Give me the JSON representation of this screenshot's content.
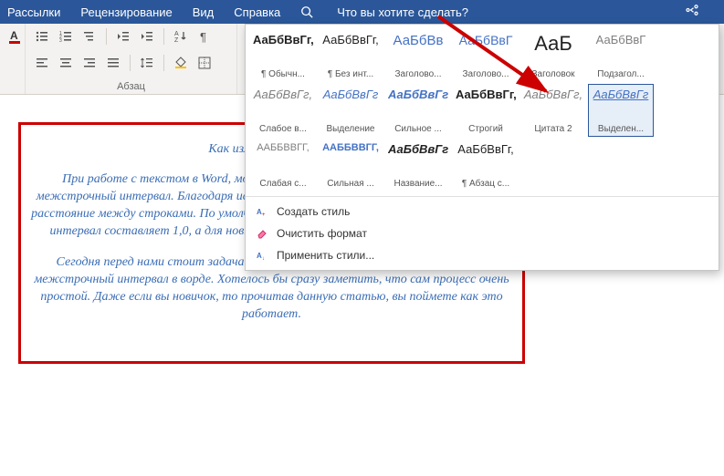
{
  "menubar": {
    "items": [
      "Рассылки",
      "Рецензирование",
      "Вид",
      "Справка"
    ],
    "search_placeholder": "Что вы хотите сделать?"
  },
  "ribbon": {
    "paragraph_label": "Абзац"
  },
  "styles": {
    "tiles": [
      {
        "sample": "АаБбВвГг,",
        "name": "¶ Обычн...",
        "css": "color:#222;font-weight:600"
      },
      {
        "sample": "АаБбВвГг,",
        "name": "¶ Без инт...",
        "css": "color:#222"
      },
      {
        "sample": "АаБбВв",
        "name": "Заголово...",
        "css": "color:#4472c4;font-size:15px"
      },
      {
        "sample": "АаБбВвГ",
        "name": "Заголово...",
        "css": "color:#4472c4;font-size:14px"
      },
      {
        "sample": "АаБ",
        "name": "Заголовок",
        "css": "color:#222;font-size:22px"
      },
      {
        "sample": "АаБбВвГ",
        "name": "Подзагол...",
        "css": "color:#7f7f7f"
      },
      {
        "sample": "АаБбВвГг,",
        "name": "Слабое в...",
        "css": "color:#7f7f7f;font-style:italic"
      },
      {
        "sample": "АаБбВвГг",
        "name": "Выделение",
        "css": "color:#4472c4;font-style:italic"
      },
      {
        "sample": "АаБбВвГг",
        "name": "Сильное ...",
        "css": "color:#4472c4;font-style:italic;font-weight:600"
      },
      {
        "sample": "АаБбВвГг,",
        "name": "Строгий",
        "css": "color:#222;font-weight:700"
      },
      {
        "sample": "АаБбВвГг,",
        "name": "Цитата 2",
        "css": "color:#7f7f7f;font-style:italic"
      },
      {
        "sample": "АаБбВвГг",
        "name": "Выделен...",
        "css": "color:#4472c4;font-style:italic;text-decoration:underline"
      },
      {
        "sample": "ААББВВГГ,",
        "name": "Слабая с...",
        "css": "color:#7f7f7f;font-size:11px"
      },
      {
        "sample": "ААББВВГГ,",
        "name": "Сильная ...",
        "css": "color:#4472c4;font-weight:700;font-size:11px"
      },
      {
        "sample": "АаБбВвГг",
        "name": "Название...",
        "css": "color:#222;font-weight:700;font-style:italic"
      },
      {
        "sample": "АаБбВвГг,",
        "name": "¶ Абзац с...",
        "css": "color:#222"
      }
    ],
    "selected_index": 11,
    "menu": {
      "create": "Создать стиль",
      "clear": "Очистить формат",
      "apply": "Применить стили..."
    }
  },
  "document": {
    "title": "Как изменить межстр",
    "p1": "При работе с текстом в Word, можно встретиться с таким понятием, как межстрочный интервал. Благодаря использованию этой функции, можно настроить расстояние между строками. По умолчанию, в версиях до MS Word 2003 межстрочный интервал составляет 1,0, а для новых версий установлено значение 1,15 строки.",
    "p2": "Сегодня перед нами стоит задача рассказать читателю о том, как изменить межстрочный интервал в ворде. Хотелось бы сразу заметить, что сам процесс очень простой. Даже если вы новичок, то прочитав данную статью, вы поймете как это работает."
  }
}
